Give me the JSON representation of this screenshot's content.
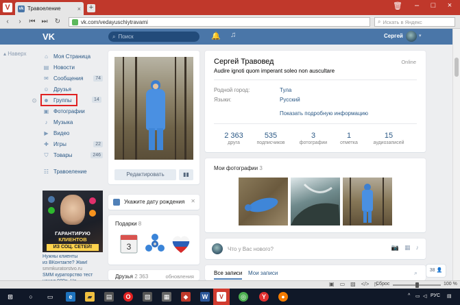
{
  "browser": {
    "tab_title": "Травоеление",
    "url": "vk.com/vedayuschiytravami",
    "search_placeholder": "Искать в Яндекс",
    "zoom_label": "Сброс",
    "zoom_value": "100 %"
  },
  "header": {
    "search_placeholder": "Поиск",
    "user_name": "Сергей"
  },
  "sidebar": {
    "back_label": "Наверх",
    "items": [
      {
        "label": "Моя Страница",
        "count": ""
      },
      {
        "label": "Новости",
        "count": ""
      },
      {
        "label": "Сообщения",
        "count": "74"
      },
      {
        "label": "Друзья",
        "count": ""
      },
      {
        "label": "Группы",
        "count": "14"
      },
      {
        "label": "Фотографии",
        "count": ""
      },
      {
        "label": "Музыка",
        "count": ""
      },
      {
        "label": "Видео",
        "count": ""
      },
      {
        "label": "Игры",
        "count": "22"
      },
      {
        "label": "Товары",
        "count": "246"
      }
    ],
    "extra_item": "Травоеление"
  },
  "ad": {
    "title_line1": "ГАРАНТИРУЮ",
    "title_line2": "КЛИЕНТОВ",
    "title_line3": "ИЗ СОЦ. СЕТЕЙ!",
    "text_line1": "Нужны клиенты",
    "text_line2": "из ВКонтакте? Жми!",
    "text_line3": "smmkuratorstvo.ru",
    "text_line4": "SMM кураторство тест",
    "text_line5": "начал 980р. Не"
  },
  "profile": {
    "edit_label": "Редактировать",
    "name": "Сергей Травовед",
    "status": "Audire ignoti quom imperant soleo non auscultare",
    "online": "Online",
    "hometown_key": "Родной город:",
    "hometown_val": "Тула",
    "languages_key": "Языки:",
    "languages_val": "Русский",
    "show_more": "Показать подробную информацию",
    "counters": [
      {
        "num": "2 363",
        "label": "друга"
      },
      {
        "num": "535",
        "label": "подписчиков"
      },
      {
        "num": "3",
        "label": "фотографии"
      },
      {
        "num": "1",
        "label": "отметка"
      },
      {
        "num": "15",
        "label": "аудиозаписей"
      }
    ]
  },
  "birthday": {
    "text": "Укажите дату рождения"
  },
  "gifts": {
    "label": "Подарки",
    "count": "8",
    "calendar_day": "3"
  },
  "friends": {
    "label": "Друзья",
    "count": "2 363",
    "updates": "обновления"
  },
  "photos": {
    "label": "Мои фотографии",
    "count": "3"
  },
  "post": {
    "placeholder": "Что у Вас нового?"
  },
  "wall": {
    "tab_all": "Все записи",
    "tab_mine": "Мои записи"
  },
  "messages_badge": "38",
  "taskbar": {
    "lang": "РУС"
  },
  "colors": {
    "browser_red": "#c0382b",
    "vk_blue": "#4a76a8",
    "link": "#2a5885",
    "page_bg": "#edeef0",
    "selected_outline": "#e02020"
  }
}
